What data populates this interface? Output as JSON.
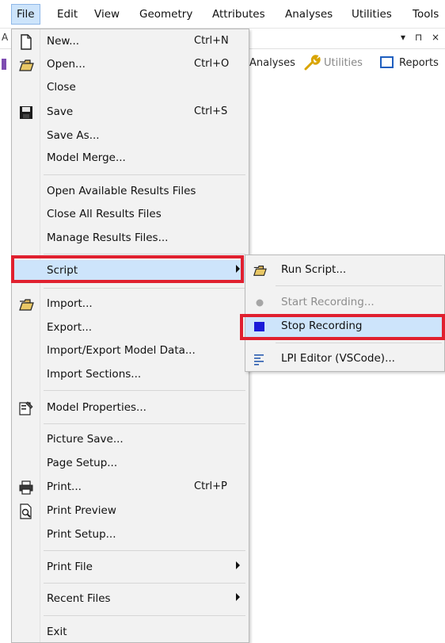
{
  "menubar": {
    "items": [
      "File",
      "Edit",
      "View",
      "Geometry",
      "Attributes",
      "Analyses",
      "Utilities",
      "Tools"
    ]
  },
  "background": {
    "left_letter": "A",
    "pin_controls": "▾ ⊓ ×",
    "toolbar_analyses": "Analyses",
    "toolbar_utilities": "Utilities",
    "toolbar_reports": "Reports"
  },
  "file_menu": {
    "items": [
      {
        "label": "New...",
        "shortcut": "Ctrl+N",
        "icon": "new-document-icon"
      },
      {
        "label": "Open...",
        "shortcut": "Ctrl+O",
        "icon": "open-folder-icon"
      },
      {
        "label": "Close",
        "shortcut": ""
      },
      {
        "label": "Save",
        "shortcut": "Ctrl+S",
        "icon": "floppy-disk-icon"
      },
      {
        "label": "Save As...",
        "shortcut": ""
      },
      {
        "label": "Model Merge...",
        "shortcut": ""
      },
      {
        "label": "Open Available Results Files",
        "shortcut": ""
      },
      {
        "label": "Close All Results Files",
        "shortcut": ""
      },
      {
        "label": "Manage Results Files...",
        "shortcut": ""
      },
      {
        "label": "Script",
        "shortcut": "",
        "submenu": true,
        "highlighted": true
      },
      {
        "label": "Import...",
        "shortcut": "",
        "icon": "open-folder-icon"
      },
      {
        "label": "Export...",
        "shortcut": ""
      },
      {
        "label": "Import/Export Model Data...",
        "shortcut": ""
      },
      {
        "label": "Import Sections...",
        "shortcut": ""
      },
      {
        "label": "Model Properties...",
        "shortcut": "",
        "icon": "properties-icon"
      },
      {
        "label": "Picture Save...",
        "shortcut": ""
      },
      {
        "label": "Page Setup...",
        "shortcut": ""
      },
      {
        "label": "Print...",
        "shortcut": "Ctrl+P",
        "icon": "printer-icon"
      },
      {
        "label": "Print Preview",
        "shortcut": "",
        "icon": "print-preview-icon"
      },
      {
        "label": "Print Setup...",
        "shortcut": ""
      },
      {
        "label": "Print File",
        "shortcut": "",
        "submenu": true
      },
      {
        "label": "Recent Files",
        "shortcut": "",
        "submenu": true
      },
      {
        "label": "Exit",
        "shortcut": ""
      }
    ]
  },
  "script_submenu": {
    "items": [
      {
        "label": "Run Script...",
        "icon": "open-folder-icon"
      },
      {
        "label": "Start Recording...",
        "icon": "record-dot-icon",
        "disabled": true
      },
      {
        "label": "Stop Recording",
        "icon": "stop-square-icon",
        "highlighted": true
      },
      {
        "label": "LPI Editor (VSCode)...",
        "icon": "editor-lines-icon"
      }
    ]
  },
  "colors": {
    "highlight_fill": "#cde4fb",
    "annotation_red": "#e0202f",
    "stop_blue": "#1a1ad8"
  }
}
